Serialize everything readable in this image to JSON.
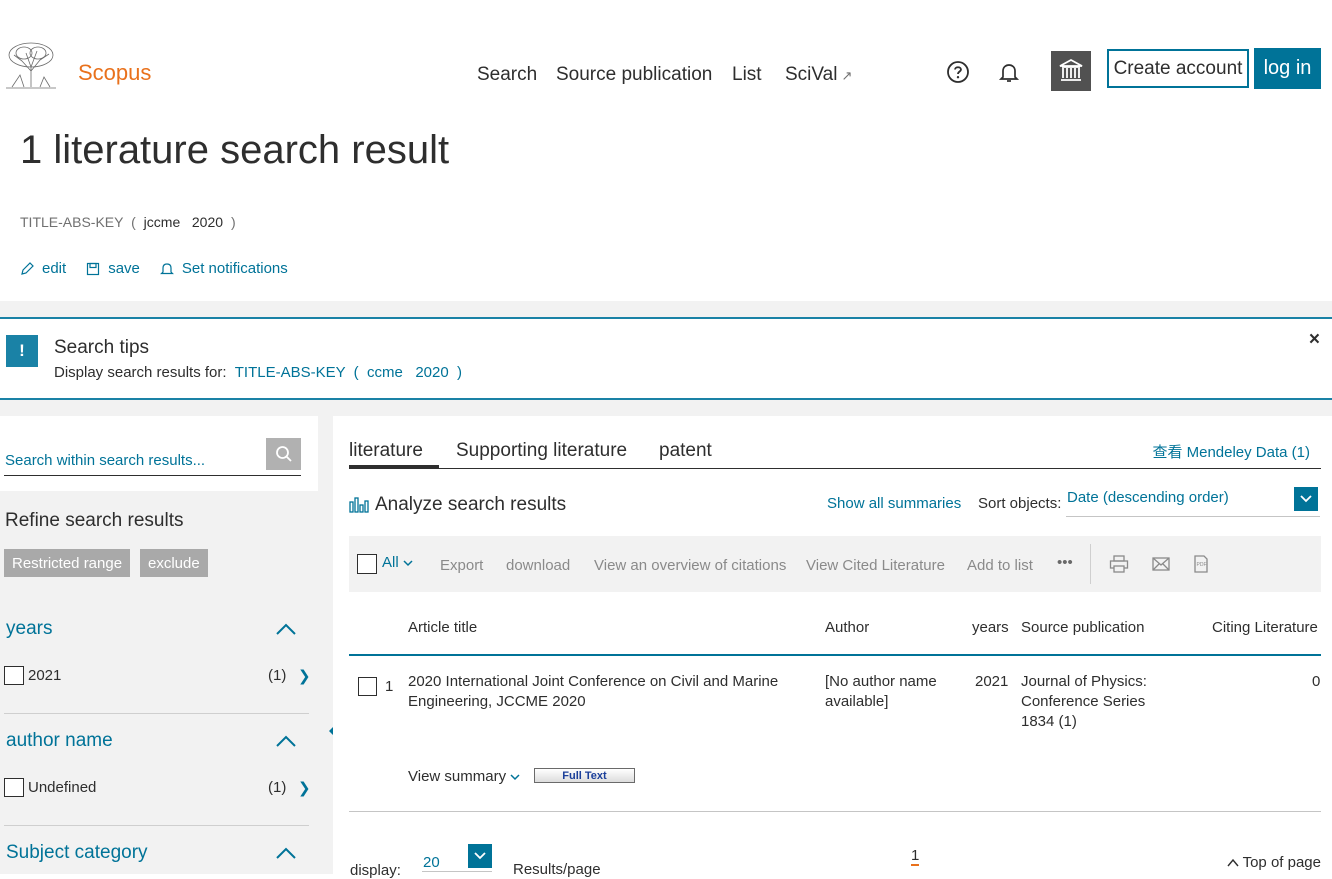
{
  "header": {
    "brand": "Scopus",
    "nav": [
      "Search",
      "Source publication",
      "List",
      "SciVal"
    ],
    "nav_external_mark": "↗",
    "create_account": "Create account",
    "login": "log in"
  },
  "page": {
    "title": "1 literature search result",
    "query_field": "TITLE-ABS-KEY",
    "query_open": "(",
    "query_terms": "jccme   2020",
    "query_close": ")",
    "actions": [
      "edit",
      "save",
      "Set notifications"
    ]
  },
  "tips": {
    "bang": "!",
    "title": "Search tips",
    "text": "Display search results for:",
    "query": "TITLE-ABS-KEY  (  ccme   2020  )",
    "close": "×"
  },
  "sidebar": {
    "search_placeholder": "Search within search results...",
    "refine_title": "Refine search results",
    "chips": [
      "Restricted range",
      "exclude"
    ],
    "facets": [
      {
        "title": "years",
        "items": [
          {
            "label": "2021",
            "count": "(1)"
          }
        ]
      },
      {
        "title": "author name",
        "items": [
          {
            "label": "Undefined",
            "count": "(1)"
          }
        ]
      },
      {
        "title": "Subject category",
        "items": []
      }
    ]
  },
  "main": {
    "tabs": [
      "literature",
      "Supporting literature",
      "patent"
    ],
    "active_tab": "literature",
    "mendeley": "查看 Mendeley Data (1)",
    "analyze": "Analyze search results",
    "show_all": "Show all summaries",
    "sort_label": "Sort objects:",
    "sort_value": "Date (descending order)",
    "toolbar": {
      "all": "All",
      "items": [
        "Export",
        "download",
        "View an overview of citations",
        "View Cited Literature",
        "Add to list"
      ],
      "more": "•••"
    },
    "table": {
      "headers": [
        "Article title",
        "Author",
        "years",
        "Source publication",
        "Citing Literature"
      ],
      "rows": [
        {
          "num": "1",
          "title_line1": "2020 International Joint Conference on Civil and Marine",
          "title_line2": "Engineering, JCCME 2020",
          "author_line1": "[No author name",
          "author_line2": "available]",
          "year": "2021",
          "source_line1": "Journal of Physics:",
          "source_line2": "Conference Series",
          "source_line3": "1834 (1)",
          "citing": "0",
          "view_summary": "View summary",
          "full_text": "Full Text"
        }
      ]
    },
    "pager": {
      "display_label": "display:",
      "display_value": "20",
      "results_per_page": "Results/page",
      "current_page": "1",
      "top_of_page": "Top of page"
    }
  },
  "colors": {
    "brand_orange": "#e9711c",
    "link_blue": "#007398",
    "tips_blue": "#1a82a6",
    "institution_grey": "#515151"
  }
}
